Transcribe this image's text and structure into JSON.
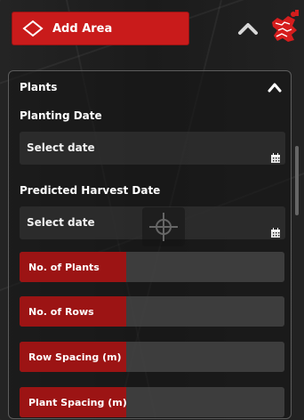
{
  "toolbar": {
    "add_area_label": "Add Area",
    "add_area_icon": "diamond-outline-icon",
    "collapse_icon": "chevron-up-icon",
    "map_logo_icon": "red-map-logo-icon"
  },
  "colors": {
    "accent": "#c91b1b",
    "metric_tag": "#9c1414",
    "panel_background": "#181818",
    "field_background": "#3a3a3a",
    "text": "#ffffff"
  },
  "panel": {
    "section_title": "Plants",
    "toggle_icon": "chevron-up-icon",
    "planting_date_label": "Planting Date",
    "planting_date_value": "Select date",
    "predicted_harvest_date_label": "Predicted Harvest Date",
    "predicted_harvest_date_value": "Select date",
    "calendar_icon": "calendar-icon",
    "metrics": [
      {
        "label": "No. of Plants",
        "value": ""
      },
      {
        "label": "No. of Rows",
        "value": ""
      },
      {
        "label": "Row Spacing (m)",
        "value": ""
      },
      {
        "label": "Plant Spacing (m)",
        "value": ""
      }
    ]
  },
  "map": {
    "crosshair_icon": "crosshair-icon"
  }
}
